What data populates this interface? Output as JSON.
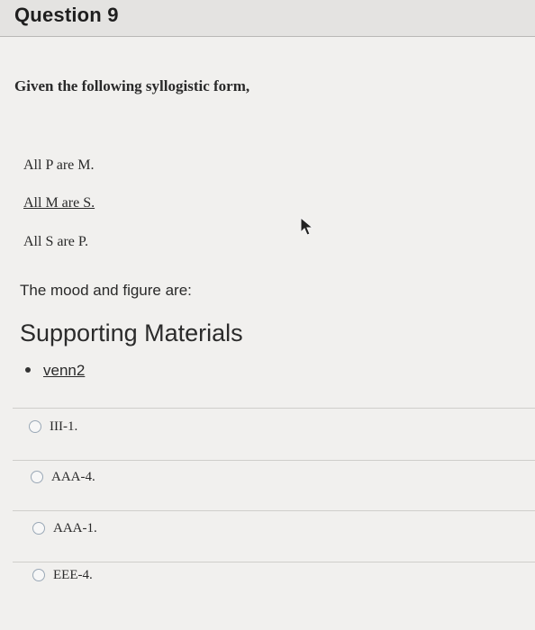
{
  "question": {
    "title": "Question 9"
  },
  "prompt": "Given the following syllogistic form,",
  "premises": [
    "All P are M.",
    "All M are S.",
    "All S are P."
  ],
  "sub_question": "The mood and figure are:",
  "supporting": {
    "heading": "Supporting Materials",
    "link": "venn2"
  },
  "options": [
    "III-1.",
    "AAA-4.",
    "AAA-1.",
    "EEE-4."
  ]
}
